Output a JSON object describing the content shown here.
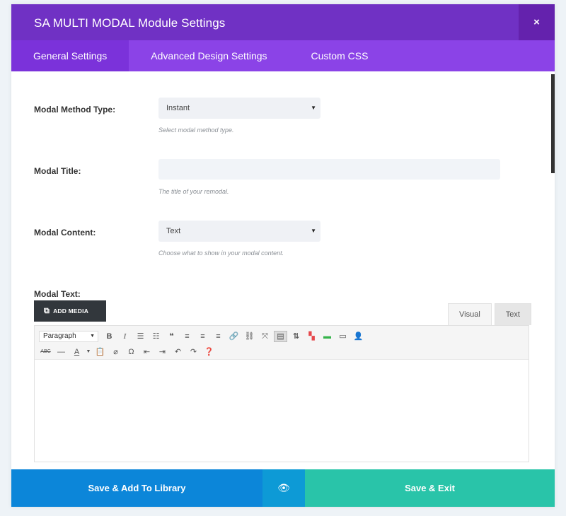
{
  "header": {
    "title": "SA MULTI MODAL Module Settings",
    "close_label": "×"
  },
  "tabs": [
    {
      "label": "General Settings",
      "active": true
    },
    {
      "label": "Advanced Design Settings",
      "active": false
    },
    {
      "label": "Custom CSS",
      "active": false
    }
  ],
  "fields": {
    "method": {
      "label": "Modal Method Type:",
      "value": "Instant",
      "help": "Select modal method type."
    },
    "title": {
      "label": "Modal Title:",
      "value": "",
      "help": "The title of your remodal."
    },
    "content": {
      "label": "Modal Content:",
      "value": "Text",
      "help": "Choose what to show in your modal content."
    },
    "text": {
      "label": "Modal Text:"
    }
  },
  "editor": {
    "add_media_label": "ADD MEDIA",
    "tab_visual": "Visual",
    "tab_text": "Text",
    "format_value": "Paragraph"
  },
  "footer": {
    "save_library_label": "Save & Add To Library",
    "save_exit_label": "Save & Exit"
  },
  "colors": {
    "header": "#7031c4",
    "tabs": "#8b43e7",
    "save_library": "#0c86d9",
    "save_exit": "#29c4a9"
  }
}
